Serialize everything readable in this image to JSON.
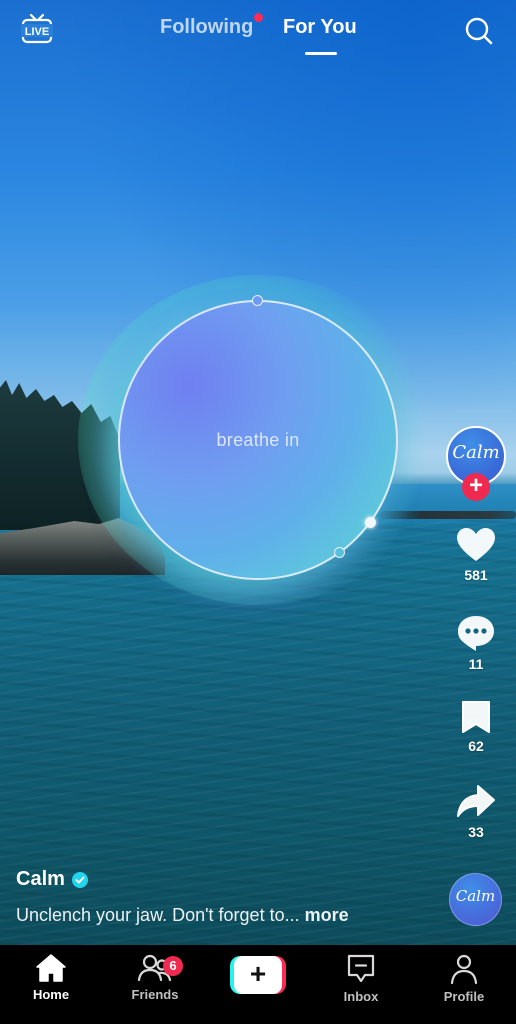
{
  "header": {
    "live_label": "LIVE",
    "tabs": [
      {
        "label": "Following",
        "active": false,
        "has_notification_dot": true
      },
      {
        "label": "For You",
        "active": true
      }
    ],
    "icons": {
      "live": "live-tv-icon",
      "search": "search-icon"
    }
  },
  "video": {
    "overlay_text": "breathe in",
    "scene": "breathing circle over ocean and forested island"
  },
  "creator": {
    "name": "Calm",
    "avatar_logo": "Calm",
    "verified": true,
    "follow_symbol": "+"
  },
  "actions": [
    {
      "name": "like",
      "icon": "heart-icon",
      "count": "581"
    },
    {
      "name": "comment",
      "icon": "comment-icon",
      "count": "11"
    },
    {
      "name": "save",
      "icon": "bookmark-icon",
      "count": "62"
    },
    {
      "name": "share",
      "icon": "share-arrow-icon",
      "count": "33"
    }
  ],
  "caption": {
    "text": "Unclench your jaw. Don't forget to...",
    "more_label": "more"
  },
  "music_disc": {
    "logo": "Calm"
  },
  "bottom_nav": {
    "items": [
      {
        "label": "Home",
        "icon": "home-icon",
        "active": true
      },
      {
        "label": "Friends",
        "icon": "friends-icon",
        "badge": "6"
      },
      {
        "label": "",
        "icon": "plus-icon",
        "role": "create"
      },
      {
        "label": "Inbox",
        "icon": "inbox-icon"
      },
      {
        "label": "Profile",
        "icon": "profile-icon"
      }
    ],
    "create_symbol": "+"
  },
  "colors": {
    "accent_red": "#fe2c55",
    "accent_cyan": "#25f4ee",
    "verified_blue": "#20d5ec",
    "nav_background": "#000000"
  }
}
